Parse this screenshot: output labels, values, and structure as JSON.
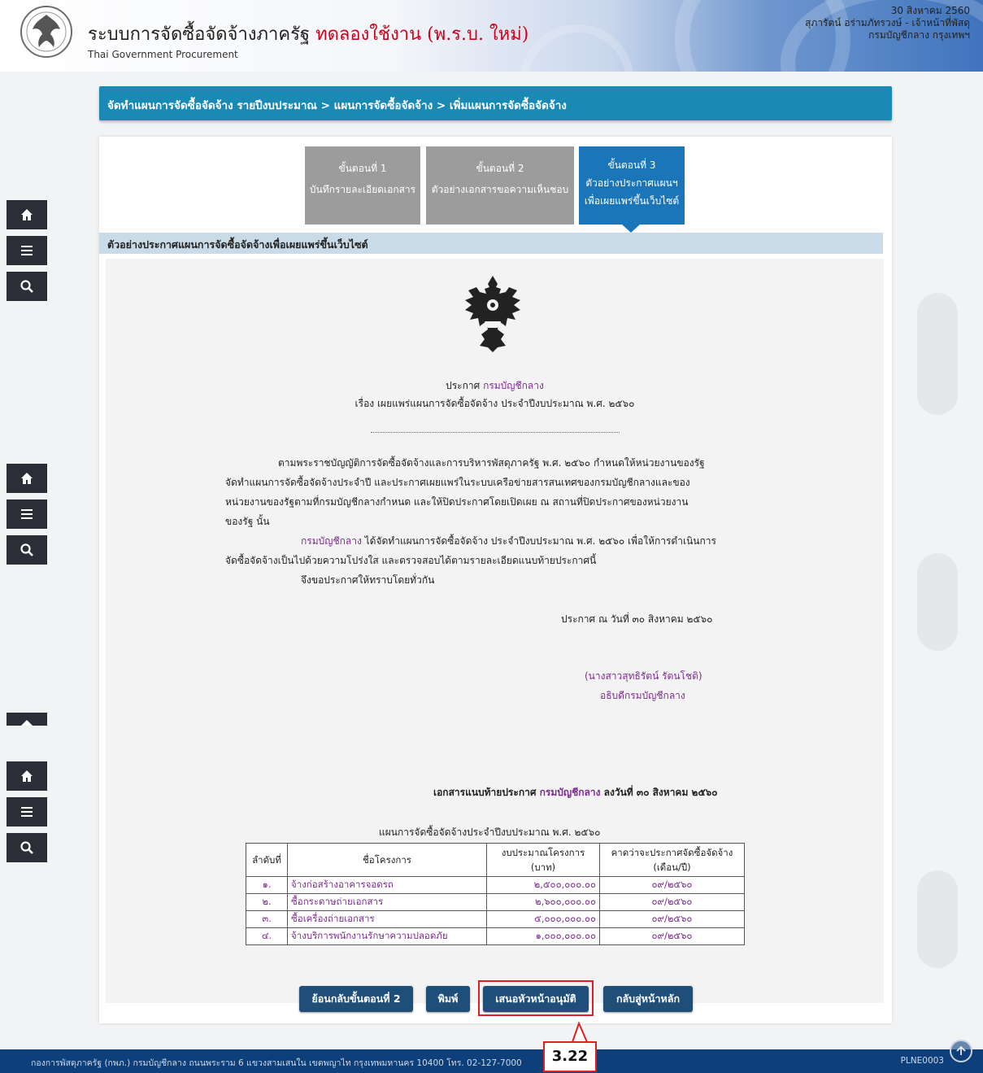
{
  "header": {
    "title_main": "ระบบการจัดซื้อจัดจ้างภาครัฐ",
    "title_trial": "ทดลองใช้งาน (พ.ร.บ. ใหม่)",
    "subtitle": "Thai Government Procurement",
    "date": "30 สิงหาคม 2560",
    "user": "สุภารัตน์ อร่ามภัทรวงษ์ - เจ้าหน้าที่พัสดุ",
    "org": "กรมบัญชีกลาง กรุงเทพฯ"
  },
  "rail_icons": [
    "home-icon",
    "menu-icon",
    "search-icon"
  ],
  "breadcrumb": "จัดทำแผนการจัดซื้อจัดจ้าง รายปีงบประมาณ > แผนการจัดซื้อจัดจ้าง > เพิ่มแผนการจัดซื้อจัดจ้าง",
  "steps": [
    {
      "title": "ขั้นตอนที่ 1",
      "desc": "บันทึกรายละเอียดเอกสาร",
      "active": false
    },
    {
      "title": "ขั้นตอนที่ 2",
      "desc": "ตัวอย่างเอกสารขอความเห็นชอบ",
      "active": false
    },
    {
      "title": "ขั้นตอนที่ 3",
      "desc": "ตัวอย่างประกาศแผนฯ",
      "desc2": "เพื่อเผยแพร่ขึ้นเว็บไซต์",
      "active": true
    }
  ],
  "section_title": "ตัวอย่างประกาศแผนการจัดซื้อจัดจ้างเพื่อเผยแพร่ขึ้นเว็บไซต์",
  "document": {
    "announce_prefix": "ประกาศ",
    "agency": "กรมบัญชีกลาง",
    "subject": "เรื่อง เผยแพร่แผนการจัดซื้อจัดจ้าง ประจำปีงบประมาณ พ.ศ. ๒๕๖๐",
    "para1_line1": "ตามพระราชบัญญัติการจัดซื้อจัดจ้างและการบริหารพัสดุภาครัฐ พ.ศ. ๒๕๖๐ กำหนดให้หน่วยงานของรัฐ",
    "para1_line2": "จัดทำแผนการจัดซื้อจัดจ้างประจำปี และประกาศเผยแพร่ในระบบเครือข่ายสารสนเทศของกรมบัญชีกลางและของ",
    "para1_line3": "หน่วยงานของรัฐตามที่กรมบัญชีกลางกำหนด และให้ปิดประกาศโดยเปิดเผย ณ สถานที่ปิดประกาศของหน่วยงาน",
    "para1_line4": "ของรัฐ นั้น",
    "para2_agency": "กรมบัญชีกลาง",
    "para2_line1_rest": " ได้จัดทำแผนการจัดซื้อจัดจ้าง ประจำปีงบประมาณ พ.ศ. ๒๕๖๐ เพื่อให้การดำเนินการ",
    "para2_line2": "จัดซื้อจัดจ้างเป็นไปด้วยความโปร่งใส และตรวจสอบได้ตามรายละเอียดแนบท้ายประกาศนี้",
    "para3": "จึงขอประกาศให้ทราบโดยทั่วกัน",
    "announce_date": "ประกาศ ณ วันที่ ๓๐ สิงหาคม ๒๕๖๐",
    "signer_name": "(นางสาวสุทธิรัตน์ รัตนโชติ)",
    "signer_title": "อธิบดีกรมบัญชีกลาง",
    "attachment_prefix": "เอกสารแนบท้ายประกาศ",
    "attachment_agency": "กรมบัญชีกลาง",
    "attachment_suffix": "ลงวันที่ ๓๐ สิงหาคม ๒๕๖๐",
    "plan_title": "แผนการจัดซื้อจัดจ้างประจำปีงบประมาณ พ.ศ. ๒๕๖๐"
  },
  "table": {
    "headers": {
      "no": "ลำดับที่",
      "name": "ชื่อโครงการ",
      "budget_1": "งบประมาณโครงการ",
      "budget_2": "(บาท)",
      "expected_1": "คาดว่าจะประกาศจัดซื้อจัดจ้าง",
      "expected_2": "(เดือน/ปี)"
    },
    "rows": [
      {
        "no": "๑.",
        "name": "จ้างก่อสร้างอาคารจอดรถ",
        "budget": "๒,๕๐๐,๐๐๐.๐๐",
        "date": "๐๙/๒๕๖๐"
      },
      {
        "no": "๒.",
        "name": "ซื้อกระดาษถ่ายเอกสาร",
        "budget": "๒,๖๐๐,๐๐๐.๐๐",
        "date": "๐๙/๒๕๖๐"
      },
      {
        "no": "๓.",
        "name": "ซื้อเครื่องถ่ายเอกสาร",
        "budget": "๕,๐๐๐,๐๐๐.๐๐",
        "date": "๐๙/๒๕๖๐"
      },
      {
        "no": "๔.",
        "name": "จ้างบริการพนักงานรักษาความปลอดภัย",
        "budget": "๑,๐๐๐,๐๐๐.๐๐",
        "date": "๐๙/๒๕๖๐"
      }
    ]
  },
  "buttons": {
    "back": "ย้อนกลับขั้นตอนที่ 2",
    "print": "พิมพ์",
    "submit": "เสนอหัวหน้าอนุมัติ",
    "home": "กลับสู่หน้าหลัก"
  },
  "callout": "3.22",
  "footer": {
    "text": "กองการพัสดุภาครัฐ (กพภ.) กรมบัญชีกลาง ถนนพระราม 6 แขวงสามเสนใน เขตพญาไท กรุงเทพมหานคร 10400 โทร. 02-127-7000",
    "code": "PLNE0003"
  },
  "colors": {
    "breadcrumb_bg": "#1a8ab4",
    "step_active": "#1a76b8",
    "step_inactive": "#9c9c9c",
    "button_bg": "#1f4e78",
    "highlight": "#e02020",
    "accent_purple": "#7b2c8e",
    "footer_bg": "#0d3f7a"
  }
}
